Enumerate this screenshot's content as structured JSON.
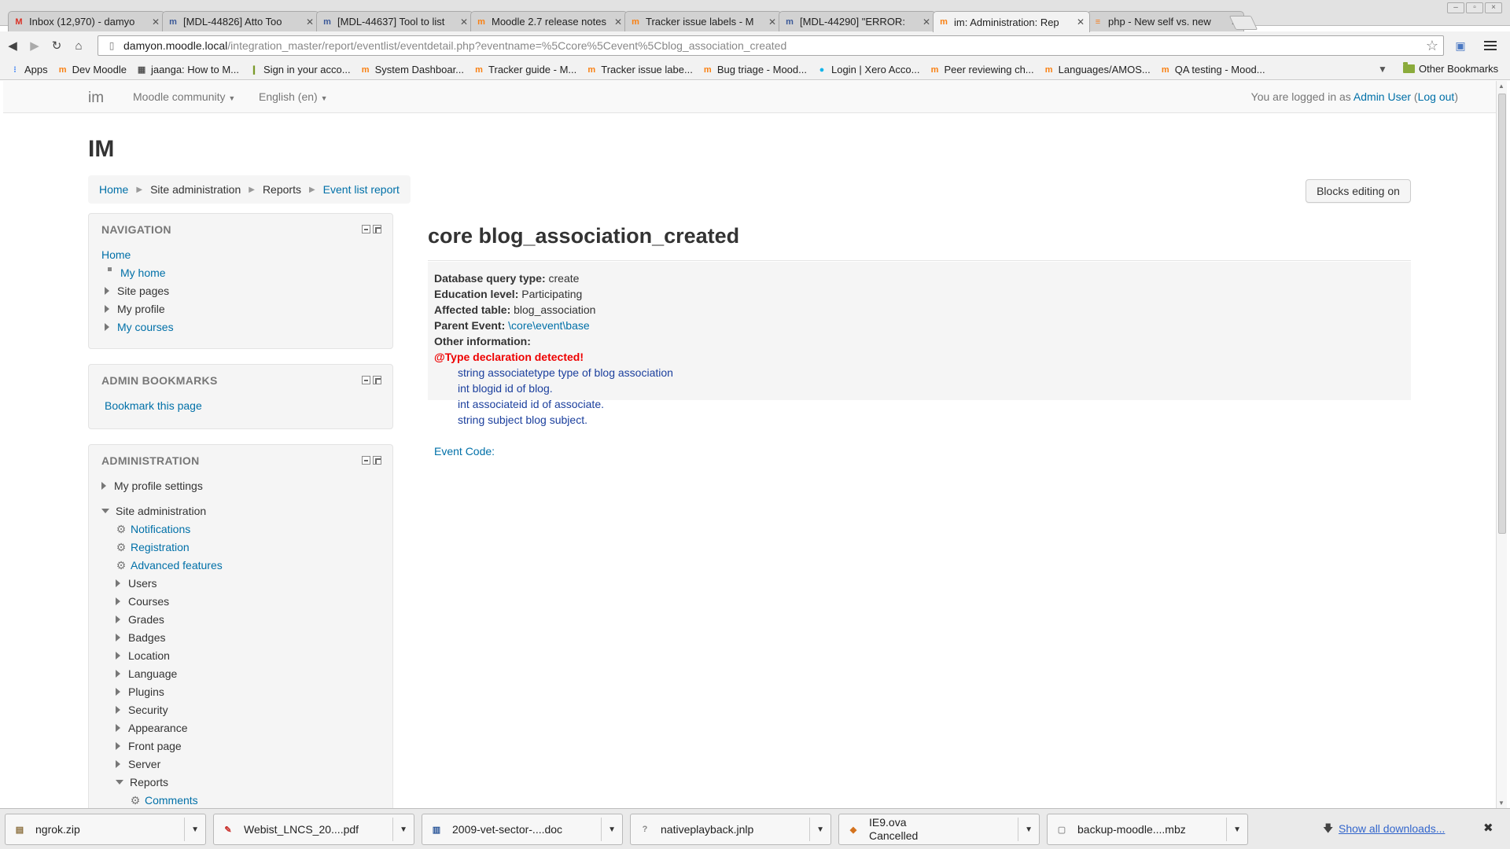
{
  "tabs": [
    {
      "title": "Inbox (12,970) - damyo",
      "icon": "gmail-icon",
      "icon_char": "M",
      "icon_color": "#d93025",
      "active": false
    },
    {
      "title": "[MDL-44826] Atto Too",
      "icon": "jira-icon",
      "icon_char": "m",
      "icon_color": "#3b5998",
      "active": false
    },
    {
      "title": "[MDL-44637] Tool to list",
      "icon": "jira-icon",
      "icon_char": "m",
      "icon_color": "#3b5998",
      "active": false
    },
    {
      "title": "Moodle 2.7 release notes",
      "icon": "moodle-icon",
      "icon_char": "m",
      "icon_color": "#f98012",
      "active": false
    },
    {
      "title": "Tracker issue labels - M",
      "icon": "moodle-icon",
      "icon_char": "m",
      "icon_color": "#f98012",
      "active": false
    },
    {
      "title": "[MDL-44290] \"ERROR:",
      "icon": "jira-icon",
      "icon_char": "m",
      "icon_color": "#3b5998",
      "active": false
    },
    {
      "title": "im: Administration: Rep",
      "icon": "moodle-icon",
      "icon_char": "m",
      "icon_color": "#f98012",
      "active": true
    },
    {
      "title": "php - New self vs. new",
      "icon": "stackoverflow-icon",
      "icon_char": "≡",
      "icon_color": "#f48024",
      "active": false
    }
  ],
  "address": {
    "host": "damyon.moodle.local",
    "path": "/integration_master/report/eventlist/eventdetail.php?eventname=%5Ccore%5Cevent%5Cblog_association_created"
  },
  "bookmarks": [
    {
      "label": "Apps",
      "icon": "apps-icon",
      "icon_char": "⁝",
      "icon_color": "#4285f4"
    },
    {
      "label": "Dev Moodle",
      "icon": "moodle-icon",
      "icon_char": "m",
      "icon_color": "#f98012"
    },
    {
      "label": "jaanga: How to M...",
      "icon": "page-icon",
      "icon_char": "▦",
      "icon_color": "#555"
    },
    {
      "label": "Sign in your acco...",
      "icon": "bulb-icon",
      "icon_char": "❙",
      "icon_color": "#7a9a2a"
    },
    {
      "label": "System Dashboar...",
      "icon": "moodle-icon",
      "icon_char": "m",
      "icon_color": "#f98012"
    },
    {
      "label": "Tracker guide - M...",
      "icon": "moodle-icon",
      "icon_char": "m",
      "icon_color": "#f98012"
    },
    {
      "label": "Tracker issue labe...",
      "icon": "moodle-icon",
      "icon_char": "m",
      "icon_color": "#f98012"
    },
    {
      "label": "Bug triage - Mood...",
      "icon": "moodle-icon",
      "icon_char": "m",
      "icon_color": "#f98012"
    },
    {
      "label": "Login | Xero Acco...",
      "icon": "xero-icon",
      "icon_char": "●",
      "icon_color": "#13b5ea"
    },
    {
      "label": "Peer reviewing ch...",
      "icon": "moodle-icon",
      "icon_char": "m",
      "icon_color": "#f98012"
    },
    {
      "label": "Languages/AMOS...",
      "icon": "moodle-icon",
      "icon_char": "m",
      "icon_color": "#f98012"
    },
    {
      "label": "QA testing - Mood...",
      "icon": "moodle-icon",
      "icon_char": "m",
      "icon_color": "#f98012"
    }
  ],
  "bookmarks_other": "Other Bookmarks",
  "moodle": {
    "brand": "im",
    "community_menu": "Moodle community",
    "language_menu": "English (en)",
    "login_prefix": "You are logged in as ",
    "login_user": "Admin User",
    "logout": "Log out",
    "site_title": "IM",
    "breadcrumb": [
      "Home",
      "Site administration",
      "Reports",
      "Event list report"
    ],
    "blocks_editing_button": "Blocks editing on"
  },
  "navigation_block": {
    "title": "NAVIGATION",
    "home": "Home",
    "items": [
      {
        "label": "My home",
        "type": "bullet",
        "link": true
      },
      {
        "label": "Site pages",
        "type": "collapsed",
        "link": false
      },
      {
        "label": "My profile",
        "type": "collapsed",
        "link": false
      },
      {
        "label": "My courses",
        "type": "collapsed",
        "link": true
      }
    ]
  },
  "admin_bookmarks_block": {
    "title": "ADMIN BOOKMARKS",
    "link": "Bookmark this page"
  },
  "administration_block": {
    "title": "ADMINISTRATION",
    "my_profile_settings": "My profile settings",
    "site_administration": "Site administration",
    "items": [
      {
        "label": "Notifications",
        "type": "gear",
        "link": true
      },
      {
        "label": "Registration",
        "type": "gear",
        "link": true
      },
      {
        "label": "Advanced features",
        "type": "gear",
        "link": true
      },
      {
        "label": "Users",
        "type": "collapsed",
        "link": false
      },
      {
        "label": "Courses",
        "type": "collapsed",
        "link": false
      },
      {
        "label": "Grades",
        "type": "collapsed",
        "link": false
      },
      {
        "label": "Badges",
        "type": "collapsed",
        "link": false
      },
      {
        "label": "Location",
        "type": "collapsed",
        "link": false
      },
      {
        "label": "Language",
        "type": "collapsed",
        "link": false
      },
      {
        "label": "Plugins",
        "type": "collapsed",
        "link": false
      },
      {
        "label": "Security",
        "type": "collapsed",
        "link": false
      },
      {
        "label": "Appearance",
        "type": "collapsed",
        "link": false
      },
      {
        "label": "Front page",
        "type": "collapsed",
        "link": false
      },
      {
        "label": "Server",
        "type": "collapsed",
        "link": false
      },
      {
        "label": "Reports",
        "type": "expanded",
        "link": false
      }
    ],
    "reports_children": [
      {
        "label": "Comments",
        "type": "gear",
        "link": true
      }
    ]
  },
  "event": {
    "title": "core blog_association_created",
    "db_query_type_label": "Database query type:",
    "db_query_type": "create",
    "education_level_label": "Education level:",
    "education_level": "Participating",
    "affected_table_label": "Affected table:",
    "affected_table": "blog_association",
    "parent_event_label": "Parent Event:",
    "parent_event": "\\core\\event\\base",
    "other_info_label": "Other information:",
    "type_warning": "@Type declaration detected!",
    "other_info_lines": [
      "string associatetype type of blog association",
      "int blogid id of blog.",
      "int associateid id of associate.",
      "string subject blog subject."
    ],
    "event_code_label": "Event Code:"
  },
  "downloads": [
    {
      "name": "ngrok.zip",
      "sub": "",
      "icon": "zip-icon",
      "icon_char": "▤",
      "icon_color": "#8a6d3b"
    },
    {
      "name": "Webist_LNCS_20....pdf",
      "sub": "",
      "icon": "pdf-icon",
      "icon_char": "✎",
      "icon_color": "#c9302c"
    },
    {
      "name": "2009-vet-sector-....doc",
      "sub": "",
      "icon": "doc-icon",
      "icon_char": "▥",
      "icon_color": "#2a5699"
    },
    {
      "name": "nativeplayback.jnlp",
      "sub": "",
      "icon": "unknown-file-icon",
      "icon_char": "?",
      "icon_color": "#888"
    },
    {
      "name": "IE9.ova",
      "sub": "Cancelled",
      "icon": "package-icon",
      "icon_char": "◆",
      "icon_color": "#d4731e"
    },
    {
      "name": "backup-moodle....mbz",
      "sub": "",
      "icon": "file-icon",
      "icon_char": "▢",
      "icon_color": "#999"
    }
  ],
  "show_all_downloads": "Show all downloads..."
}
